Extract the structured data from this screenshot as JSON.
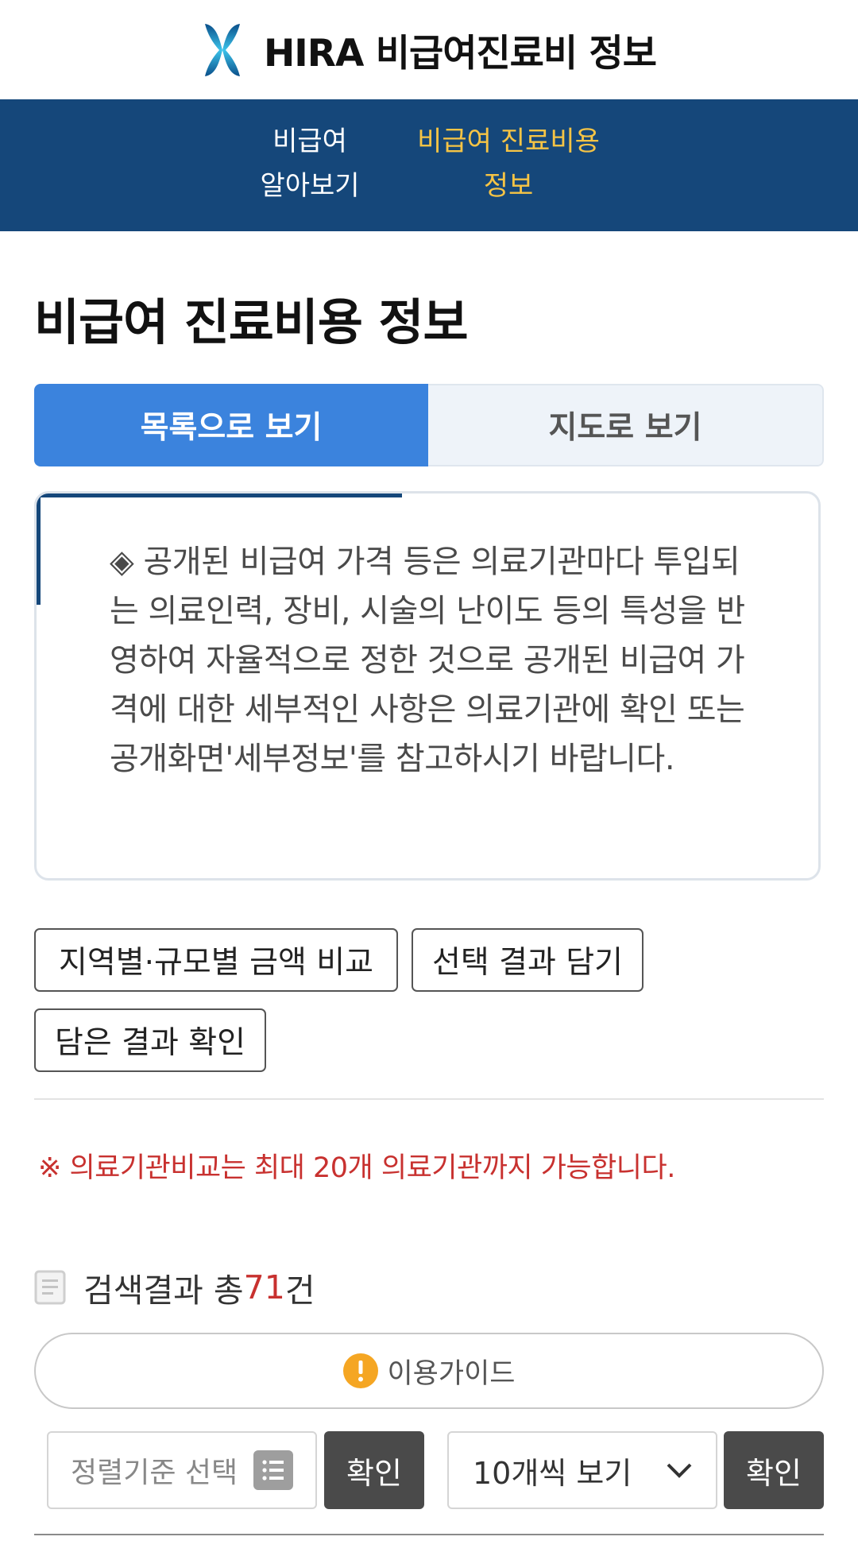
{
  "header": {
    "title": "HIRA 비급여진료비 정보",
    "logo_icon": "hira-logo-icon"
  },
  "nav": {
    "items": [
      {
        "line1": "비급여",
        "line2": "알아보기",
        "active": false
      },
      {
        "line1": "비급여 진료비용",
        "line2": "정보",
        "active": true
      }
    ],
    "active_color": "#f6c445",
    "background": "#15477a"
  },
  "page": {
    "title": "비급여 진료비용 정보"
  },
  "view_tabs": {
    "list": "목록으로 보기",
    "map": "지도로 보기",
    "active": "list"
  },
  "notice": {
    "text": "◈ 공개된 비급여 가격 등은 의료기관마다 투입되는 의료인력, 장비, 시술의 난이도 등의 특성을 반영하여 자율적으로 정한 것으로 공개된 비급여 가격에 대한 세부적인 사항은 의료기관에 확인 또는 공개화면'세부정보'를 참고하시기 바랍니다."
  },
  "actions": {
    "compare_region": "지역별·규모별 금액 비교",
    "add_selection": "선택 결과 담기",
    "view_saved": "담은 결과 확인"
  },
  "compare_note": "※ 의료기관비교는 최대 20개 의료기관까지 가능합니다.",
  "results": {
    "prefix": "검색결과 총",
    "count": "71",
    "suffix": "건"
  },
  "guide": {
    "label": "이용가이드",
    "icon": "exclamation-icon"
  },
  "controls": {
    "sort_placeholder": "정렬기준 선택",
    "confirm": "확인",
    "per_page": "10개씩 보기"
  },
  "colors": {
    "accent_blue": "#3b83dd",
    "alert_red": "#c8312f",
    "guide_orange": "#f5a623"
  }
}
